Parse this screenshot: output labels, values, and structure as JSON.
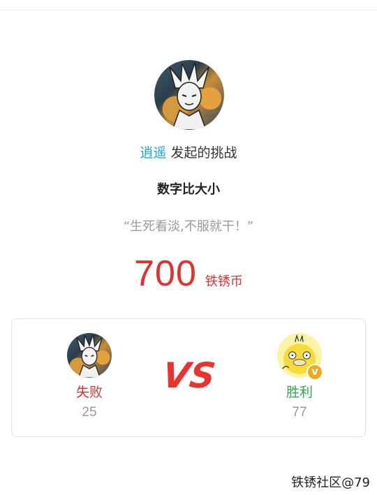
{
  "challenge": {
    "challenger_name": "逍遥",
    "challenger_suffix": "发起的挑战",
    "game_title": "数字比大小",
    "motto": "“生死看淡,不服就干！”",
    "stake_amount": "700",
    "stake_unit": "铁锈币"
  },
  "match": {
    "vs_label": "VS",
    "left": {
      "result": "失败",
      "score": "25",
      "avatar": "anime-character-avatar"
    },
    "right": {
      "result": "胜利",
      "score": "77",
      "avatar": "yellow-duck-avatar",
      "badge": "V"
    }
  },
  "footer": {
    "watermark": "铁锈社区@79"
  },
  "colors": {
    "accent_name": "#1fa3d8",
    "stake": "#e1302d",
    "lose": "#d8332d",
    "win": "#2fa94a"
  }
}
